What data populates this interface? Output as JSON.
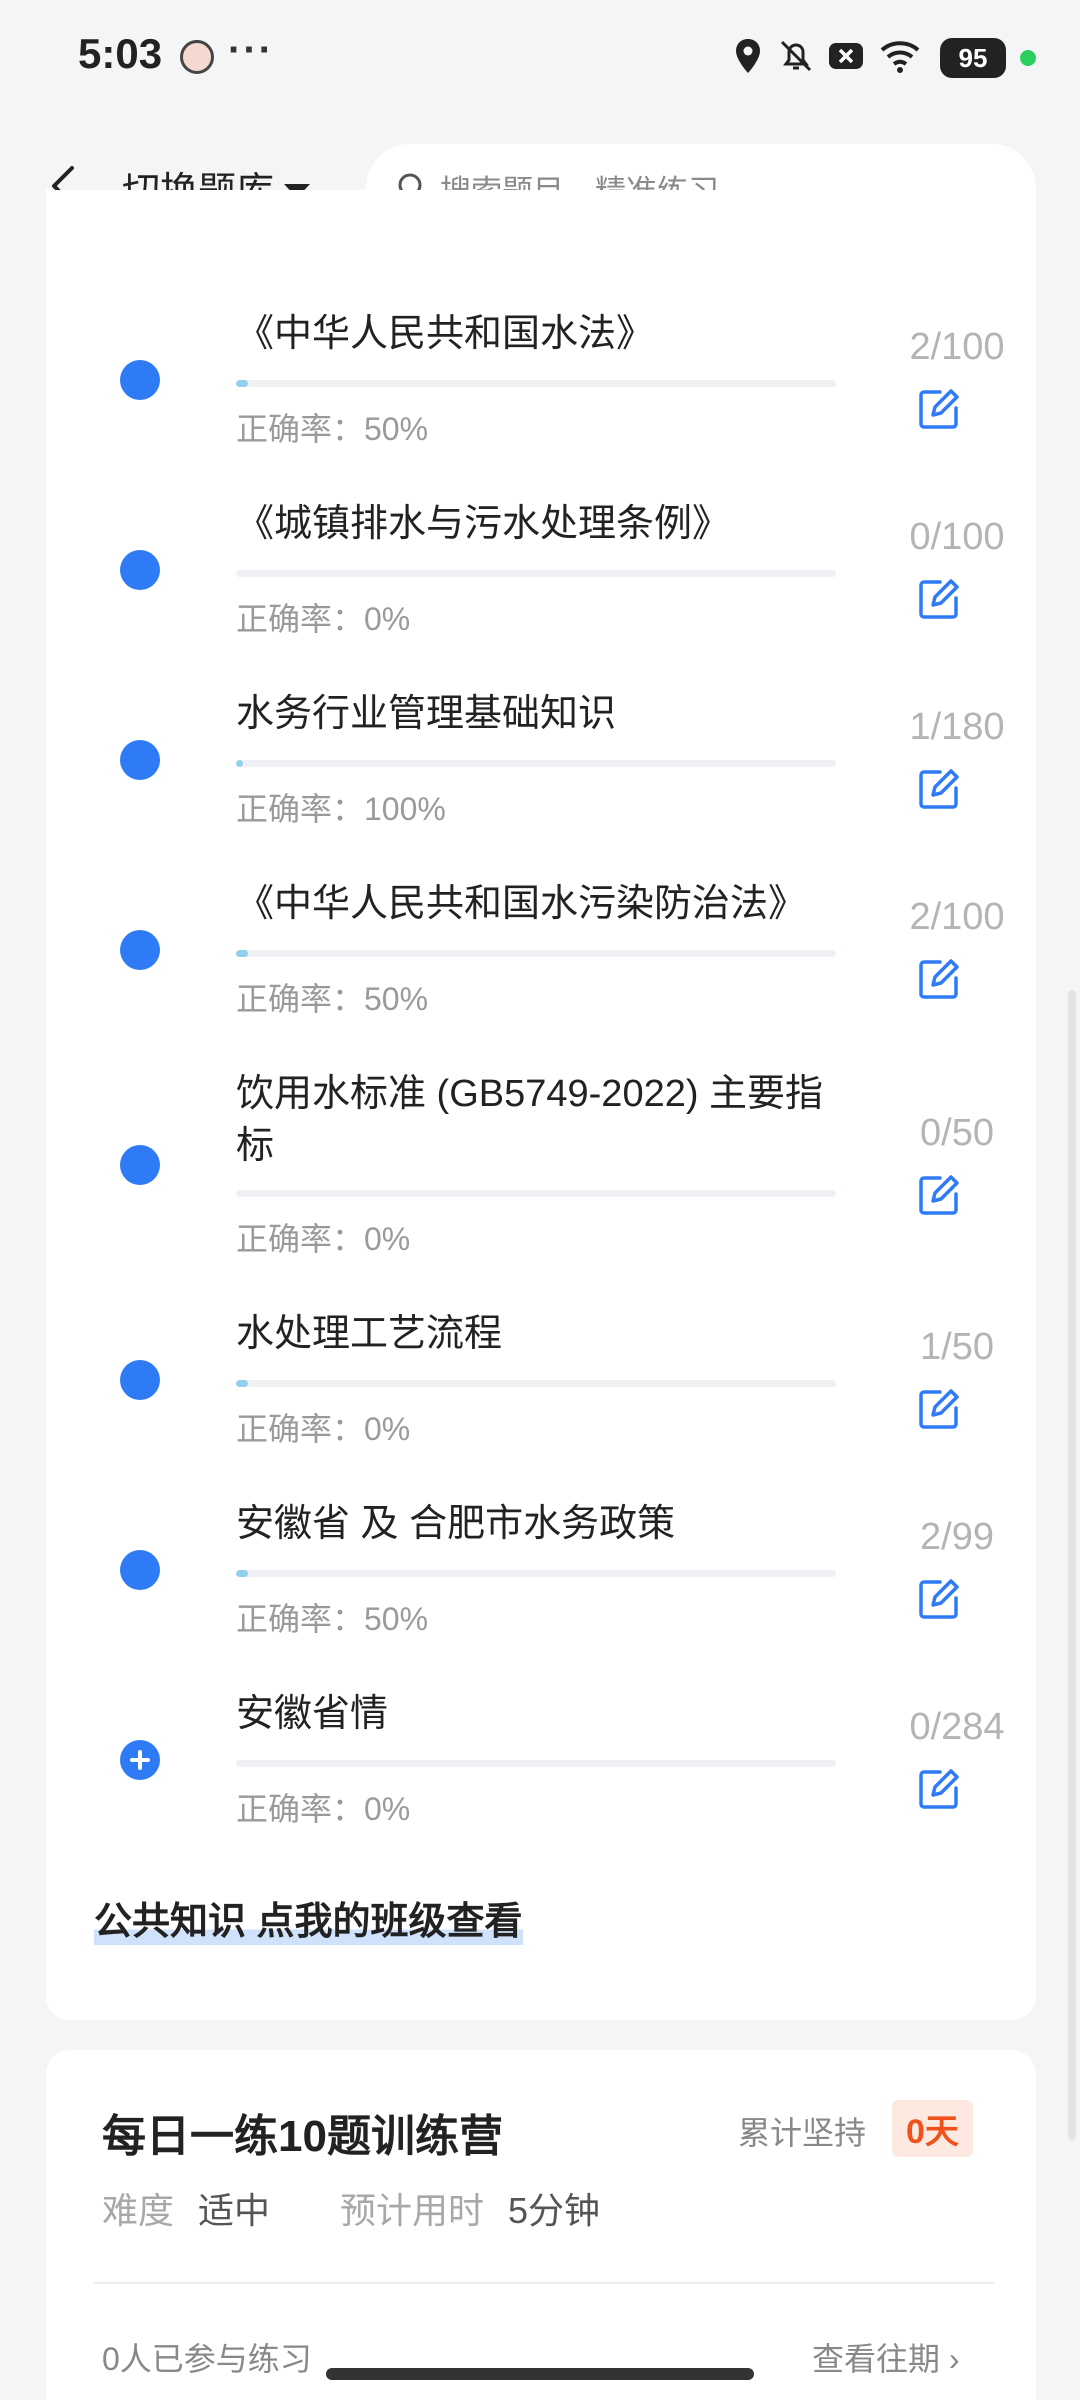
{
  "status_bar": {
    "time": "5:03",
    "dots": "···",
    "battery": "95"
  },
  "header": {
    "switch_bank_label": "切换题库",
    "search_placeholder": "搜索题目，精准练习"
  },
  "chapters": [
    {
      "title": "《中华人民共和国水法》",
      "accuracy": "正确率：50%",
      "count": "2/100",
      "progress": 0.02
    },
    {
      "title": "《城镇排水与污水处理条例》",
      "accuracy": "正确率：0%",
      "count": "0/100",
      "progress": 0.0
    },
    {
      "title": "水务行业管理基础知识",
      "accuracy": "正确率：100%",
      "count": "1/180",
      "progress": 0.006
    },
    {
      "title": "《中华人民共和国水污染防治法》",
      "accuracy": "正确率：50%",
      "count": "2/100",
      "progress": 0.02
    },
    {
      "title": "饮用水标准 (GB5749-2022) 主要指标",
      "accuracy": "正确率：0%",
      "count": "0/50",
      "progress": 0.0
    },
    {
      "title": "水处理工艺流程",
      "accuracy": "正确率：0%",
      "count": "1/50",
      "progress": 0.02
    },
    {
      "title": "安徽省 及 合肥市水务政策",
      "accuracy": "正确率：50%",
      "count": "2/99",
      "progress": 0.02
    },
    {
      "title": "安徽省情",
      "accuracy": "正确率：0%",
      "count": "0/284",
      "progress": 0.0
    }
  ],
  "public_knowledge_link": "公共知识 点我的班级查看",
  "training_camp": {
    "title": "每日一练10题训练营",
    "streak_label": "累计坚持",
    "streak_value": "0天",
    "difficulty_label": "难度",
    "difficulty_value": "适中",
    "time_label": "预计用时",
    "time_value": "5分钟",
    "participants": "0人已参与练习",
    "view_past": "查看往期"
  },
  "colors": {
    "accent": "#2f7bf5",
    "progress": "#8fd1ea",
    "streak": "#f0521c"
  }
}
